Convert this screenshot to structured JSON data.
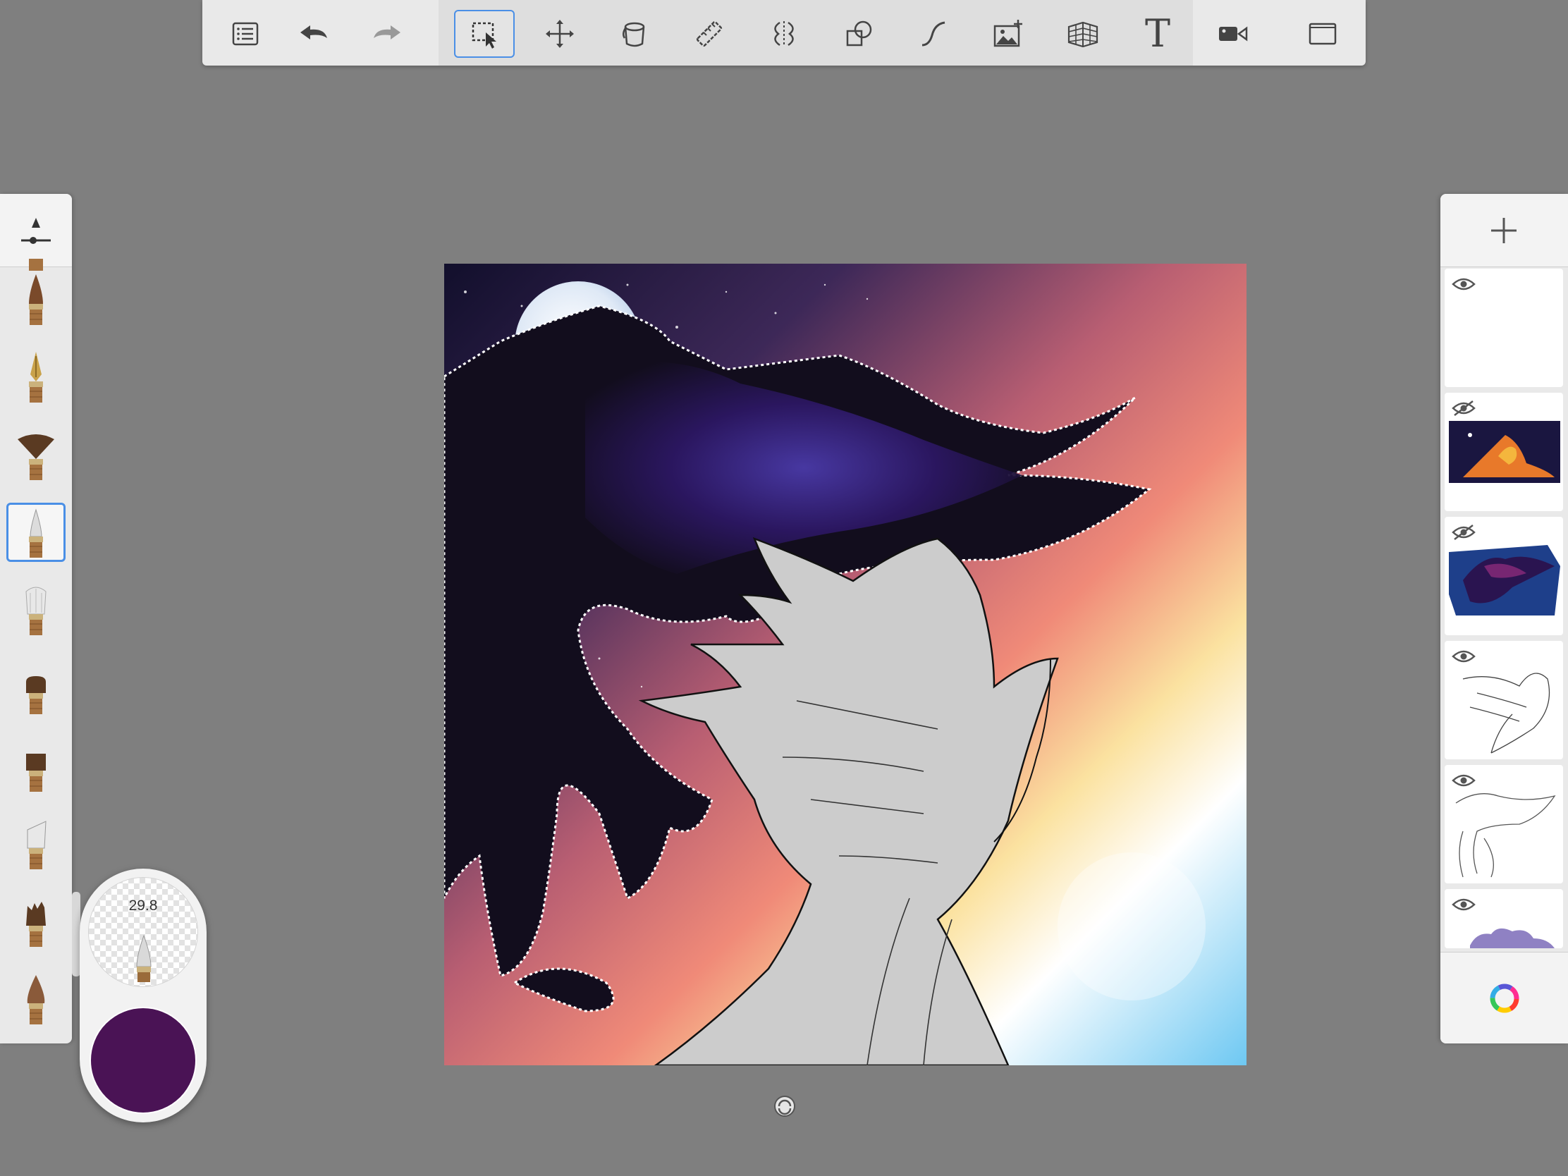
{
  "toolbar": {
    "tools": [
      {
        "id": "lagoon-menu",
        "icon": "list-icon"
      },
      {
        "id": "undo",
        "icon": "undo-arrow-icon"
      },
      {
        "id": "redo",
        "icon": "redo-arrow-icon"
      },
      {
        "id": "selection",
        "icon": "selection-marquee-icon",
        "active": true
      },
      {
        "id": "transform",
        "icon": "move-arrows-icon"
      },
      {
        "id": "fill",
        "icon": "paint-bucket-icon"
      },
      {
        "id": "ruler",
        "icon": "ruler-icon"
      },
      {
        "id": "symmetry",
        "icon": "symmetry-icon"
      },
      {
        "id": "shapes",
        "icon": "shapes-icon"
      },
      {
        "id": "stroke",
        "icon": "curve-stroke-icon"
      },
      {
        "id": "add-image",
        "icon": "add-image-icon"
      },
      {
        "id": "perspective",
        "icon": "perspective-grid-icon"
      },
      {
        "id": "text",
        "icon": "text-icon",
        "glyph": "T"
      },
      {
        "id": "time-lapse",
        "icon": "video-camera-icon"
      },
      {
        "id": "fullscreen",
        "icon": "fullscreen-icon"
      }
    ]
  },
  "brush_palette": {
    "brushes": [
      {
        "name": "paintbrush-pointed",
        "active": false
      },
      {
        "name": "ink-pen",
        "active": false
      },
      {
        "name": "fan-brush",
        "active": false
      },
      {
        "name": "airbrush",
        "active": true
      },
      {
        "name": "soft-bristle",
        "active": false
      },
      {
        "name": "flat-round",
        "active": false
      },
      {
        "name": "flat-square",
        "active": false
      },
      {
        "name": "angled-brush",
        "active": false
      },
      {
        "name": "rough-bristle",
        "active": false
      },
      {
        "name": "round-tapered",
        "active": false
      }
    ]
  },
  "puck": {
    "brush_size": "29.8",
    "color": "#4a1355"
  },
  "layers": [
    {
      "name": "layer-empty",
      "visible": true
    },
    {
      "name": "layer-phoenix-color",
      "visible": false
    },
    {
      "name": "layer-raven-galaxy",
      "visible": false
    },
    {
      "name": "layer-phoenix-lineart",
      "visible": true
    },
    {
      "name": "layer-raven-lineart",
      "visible": true
    },
    {
      "name": "layer-clouds",
      "visible": true
    }
  ],
  "colors": {
    "accent": "#4a8fe6",
    "raven": "#120d1d",
    "phoenix": "#cccccc"
  }
}
